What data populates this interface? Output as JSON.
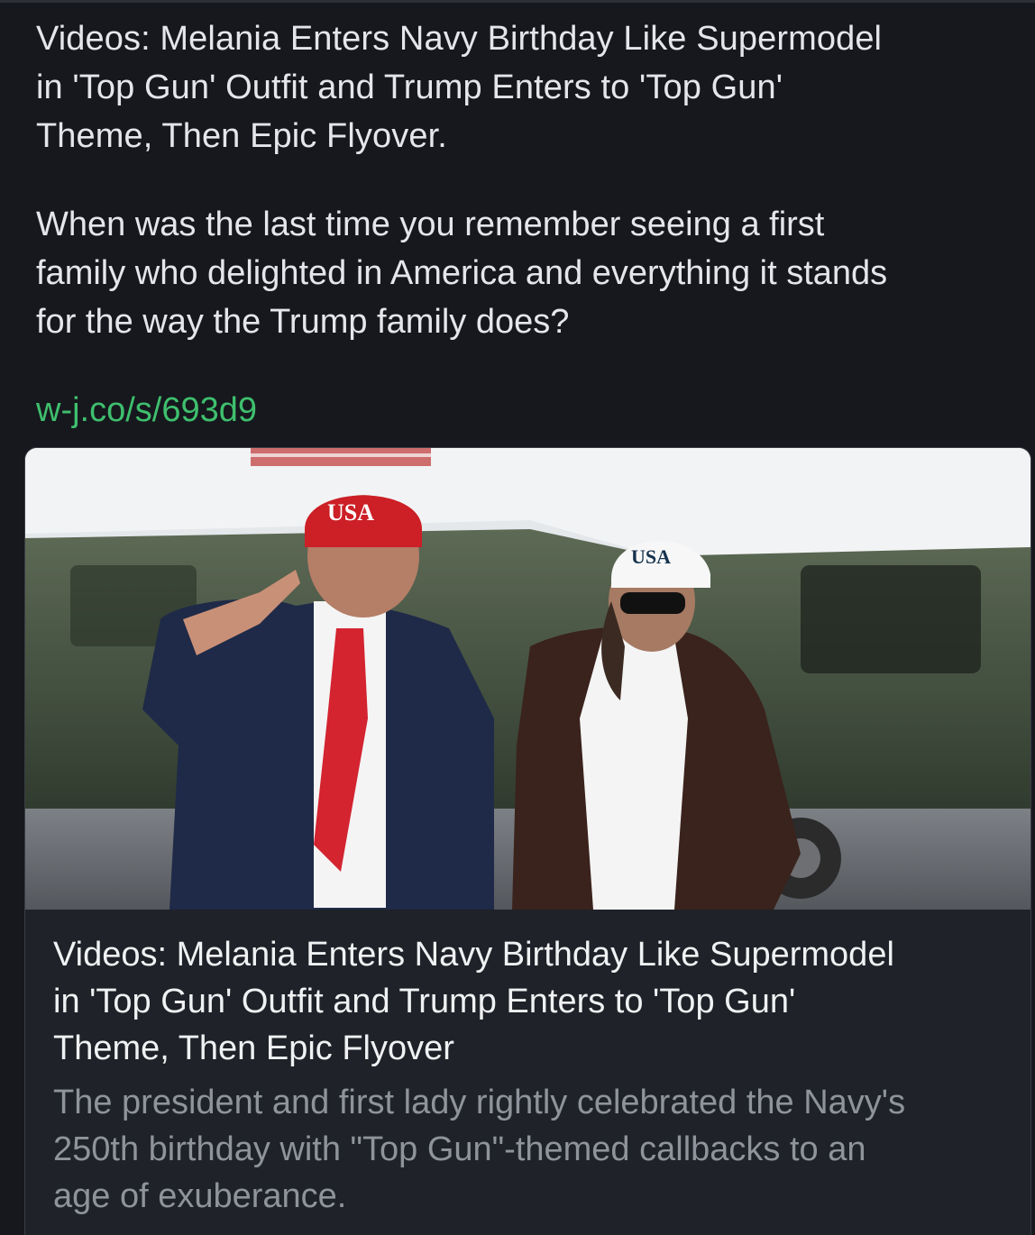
{
  "post": {
    "headline": "Videos: Melania Enters Navy Birthday Like Supermodel\nin 'Top Gun' Outfit and Trump Enters to 'Top Gun'\nTheme, Then Epic Flyover.",
    "question": "When was the last time you remember seeing a first\nfamily who delighted in America and everything it stands\nfor the way the Trump family does?",
    "link_text": "w-j.co/s/693d9"
  },
  "card": {
    "hat_left_text": "USA",
    "hat_right_text": "USA",
    "title": "Videos: Melania Enters Navy Birthday Like Supermodel\nin 'Top Gun' Outfit and Trump Enters to 'Top Gun'\nTheme, Then Epic Flyover",
    "description": "The president and first lady rightly celebrated the Navy's\n250th birthday with \"Top Gun\"-themed callbacks to an\nage of exuberance."
  },
  "colors": {
    "background": "#16181d",
    "link": "#3fbf6e",
    "card_background": "#1f2228",
    "description_text": "#8f939b"
  }
}
